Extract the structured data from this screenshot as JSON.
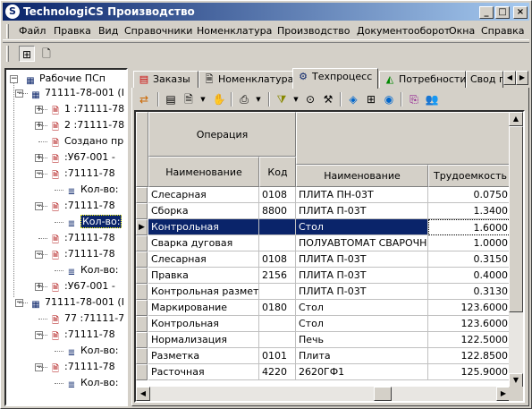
{
  "window": {
    "title": "TechnologiCS Производство",
    "minimize": "_",
    "maximize": "□",
    "close": "×"
  },
  "menu": [
    "Файл",
    "Правка",
    "Вид",
    "Справочники",
    "Номенклатура",
    "Производство",
    "Документооборот",
    "Окна",
    "Справка"
  ],
  "tree": {
    "root": "Рабочие ПСп",
    "nodes": [
      {
        "label": "71111-78-001 (I",
        "icon": "table-icon"
      },
      {
        "label": "1 :71111-78",
        "icon": "doc-icon"
      },
      {
        "label": "2 :71111-78",
        "icon": "doc-icon"
      },
      {
        "label": "Создано пр",
        "icon": "doc-icon"
      },
      {
        "label": ":У67-001 -",
        "icon": "doc-icon"
      },
      {
        "label": ":71111-78",
        "icon": "doc-icon"
      },
      {
        "label": "Кол-во:",
        "icon": "list-icon"
      },
      {
        "label": ":71111-78",
        "icon": "doc-icon"
      },
      {
        "label": "Кол-во:",
        "icon": "list-icon",
        "selected": true
      },
      {
        "label": ":71111-78",
        "icon": "doc-icon"
      },
      {
        "label": ":71111-78",
        "icon": "doc-icon"
      },
      {
        "label": "Кол-во:",
        "icon": "list-icon"
      },
      {
        "label": ":У67-001 -",
        "icon": "doc-icon"
      },
      {
        "label": "71111-78-001 (I",
        "icon": "table-icon"
      },
      {
        "label": "77 :71111-7",
        "icon": "doc-icon"
      },
      {
        "label": ":71111-78",
        "icon": "doc-icon"
      },
      {
        "label": "Кол-во:",
        "icon": "list-icon"
      },
      {
        "label": ":71111-78",
        "icon": "doc-icon"
      },
      {
        "label": "Кол-во:",
        "icon": "list-icon"
      }
    ]
  },
  "tabs": [
    "Заказы",
    "Номенклатура",
    "Техпроцесс",
    "Потребности",
    "Свод п"
  ],
  "active_tab": "Техпроцесс",
  "grid": {
    "header_group": "Операция",
    "columns": [
      "Наименование",
      "Код",
      "Наименование",
      "Трудоемкость"
    ],
    "rows": [
      [
        "Слесарная",
        "0108",
        "ПЛИТА ПН-03Т",
        "0.0750"
      ],
      [
        "Сборка",
        "8800",
        "ПЛИТА П-03Т",
        "1.3400"
      ],
      [
        "Контрольная",
        "",
        "Стол",
        "1.6000"
      ],
      [
        "Сварка дуговая",
        "",
        "ПОЛУАВТОМАТ СВАРОЧНЫ",
        "1.0000"
      ],
      [
        "Слесарная",
        "0108",
        "ПЛИТА П-03Т",
        "0.3150"
      ],
      [
        "Правка",
        "2156",
        "ПЛИТА П-03Т",
        "0.4000"
      ],
      [
        "Контрольная разметка",
        "",
        "ПЛИТА П-03Т",
        "0.3130"
      ],
      [
        "Маркирование",
        "0180",
        "Стол",
        "123.6000"
      ],
      [
        "Контрольная",
        "",
        "Стол",
        "123.6000"
      ],
      [
        "Нормализация",
        "",
        "Печь",
        "122.5000"
      ],
      [
        "Разметка",
        "0101",
        "Плита",
        "122.8500"
      ],
      [
        "Расточная",
        "4220",
        "2620ГФ1",
        "125.9000"
      ]
    ],
    "selected_row": 2,
    "row_indicator": "▶"
  }
}
